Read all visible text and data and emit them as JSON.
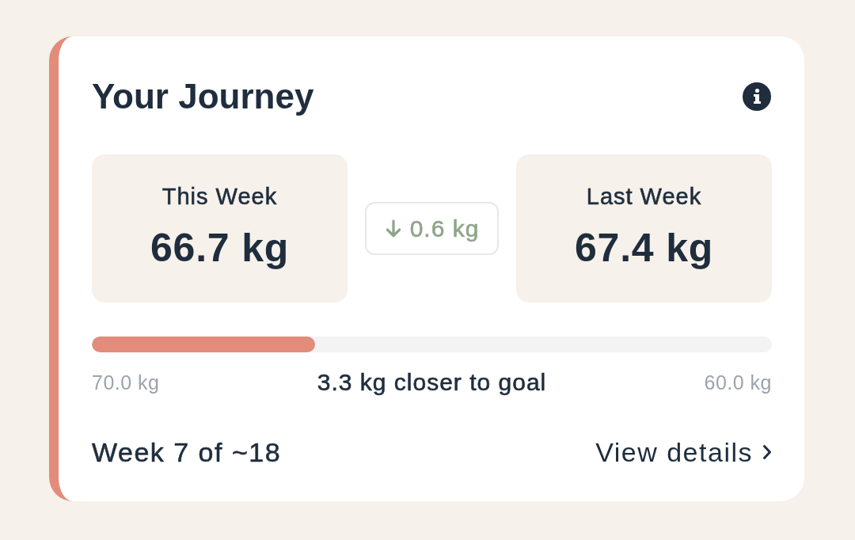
{
  "card": {
    "title": "Your Journey",
    "stats": [
      {
        "label": "This Week",
        "value": "66.7 kg"
      },
      {
        "label": "Last Week",
        "value": "67.4 kg"
      }
    ],
    "change": {
      "decreased": true,
      "text": "0.6 kg"
    },
    "progress": {
      "level": 0.328,
      "start_label": "70.0 kg",
      "summary": "3.3 kg closer to goal",
      "end_label": "60.0 kg"
    },
    "week": "Week 7 of ~18",
    "details_link": "View details"
  }
}
